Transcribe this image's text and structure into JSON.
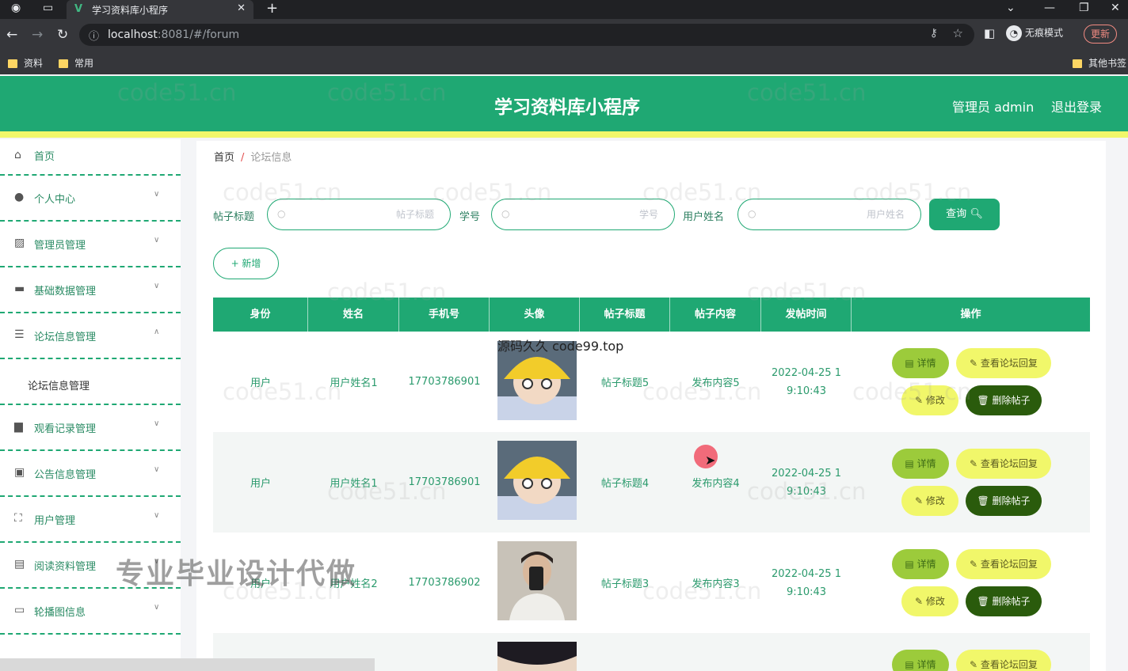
{
  "browser": {
    "tab_title": "学习资料库小程序",
    "url_host": "localhost",
    "url_rest": ":8081/#/forum",
    "incognito_label": "无痕模式",
    "update_label": "更新",
    "bookmarks": [
      "资料",
      "常用"
    ],
    "other_bookmarks": "其他书签"
  },
  "header": {
    "title": "学习资料库小程序",
    "admin": "管理员 admin",
    "logout": "退出登录"
  },
  "sidebar": {
    "items": [
      {
        "label": "首页",
        "icon": "home-icon"
      },
      {
        "label": "个人中心",
        "icon": "user-icon"
      },
      {
        "label": "管理员管理",
        "icon": "chart-icon"
      },
      {
        "label": "基础数据管理",
        "icon": "chat-icon"
      },
      {
        "label": "论坛信息管理",
        "icon": "sliders-icon"
      },
      {
        "label": "论坛信息管理",
        "icon": ""
      },
      {
        "label": "观看记录管理",
        "icon": "briefcase-icon"
      },
      {
        "label": "公告信息管理",
        "icon": "clipboard-icon"
      },
      {
        "label": "用户管理",
        "icon": "fullscreen-icon"
      },
      {
        "label": "阅读资料管理",
        "icon": "document-icon"
      },
      {
        "label": "轮播图信息",
        "icon": "monitor-icon"
      }
    ]
  },
  "overlay_text": "专业毕业设计代做",
  "source_watermark": "源码久久 code99.top",
  "breadcrumb": {
    "home": "首页",
    "current": "论坛信息"
  },
  "filters": {
    "title_label": "帖子标题",
    "title_placeholder": "帖子标题",
    "xuehao_label": "学号",
    "xuehao_placeholder": "学号",
    "name_label": "用户姓名",
    "name_placeholder": "用户姓名",
    "query_button": "查询",
    "add_button": "+ 新增"
  },
  "table": {
    "columns": [
      "身份",
      "姓名",
      "手机号",
      "头像",
      "帖子标题",
      "帖子内容",
      "发帖时间",
      "操作"
    ],
    "rows": [
      {
        "role": "用户",
        "name": "用户姓名1",
        "phone": "17703786901",
        "title": "帖子标题5",
        "content": "发布内容5",
        "time": "2022-04-25 1 9:10:43"
      },
      {
        "role": "用户",
        "name": "用户姓名1",
        "phone": "17703786901",
        "title": "帖子标题4",
        "content": "发布内容4",
        "time": "2022-04-25 1 9:10:43"
      },
      {
        "role": "用户",
        "name": "用户姓名2",
        "phone": "17703786902",
        "title": "帖子标题3",
        "content": "发布内容3",
        "time": "2022-04-25 1 9:10:43"
      }
    ],
    "actions": {
      "detail": "详情",
      "reply": "查看论坛回复",
      "edit": "修改",
      "delete": "删除帖子"
    }
  },
  "watermark": "code51.cn",
  "colors": {
    "primary": "#1fa873",
    "accent_yellow": "#f1f76a",
    "detail_green": "#9ccb3b",
    "delete_dark": "#2a5b0c"
  }
}
